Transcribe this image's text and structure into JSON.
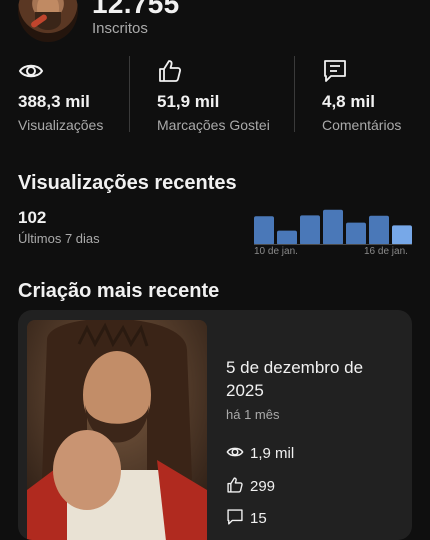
{
  "channel": {
    "subscribers_value": "12.755",
    "subscribers_label": "Inscritos"
  },
  "stats": [
    {
      "icon": "eye-icon",
      "value": "388,3 mil",
      "label": "Visualizações"
    },
    {
      "icon": "thumbs-up-icon",
      "value": "51,9 mil",
      "label": "Marcações Gostei"
    },
    {
      "icon": "comment-icon",
      "value": "4,8 mil",
      "label": "Comentários"
    }
  ],
  "recent_views": {
    "title": "Visualizações recentes",
    "count": "102",
    "period": "Últimos 7 dias",
    "chart_data": {
      "type": "bar",
      "values": [
        0.72,
        0.36,
        0.74,
        0.88,
        0.56,
        0.73,
        0.49
      ],
      "start_label": "10 de jan.",
      "end_label": "16 de jan.",
      "colors": [
        "#4a78b8",
        "#4a78b8",
        "#4a78b8",
        "#4a78b8",
        "#4a78b8",
        "#4a78b8",
        "#77a8e8"
      ]
    }
  },
  "latest": {
    "title": "Criação mais recente",
    "date": "5 de dezembro de 2025",
    "ago": "há 1 mês",
    "views": "1,9 mil",
    "likes": "299",
    "comments": "15"
  }
}
